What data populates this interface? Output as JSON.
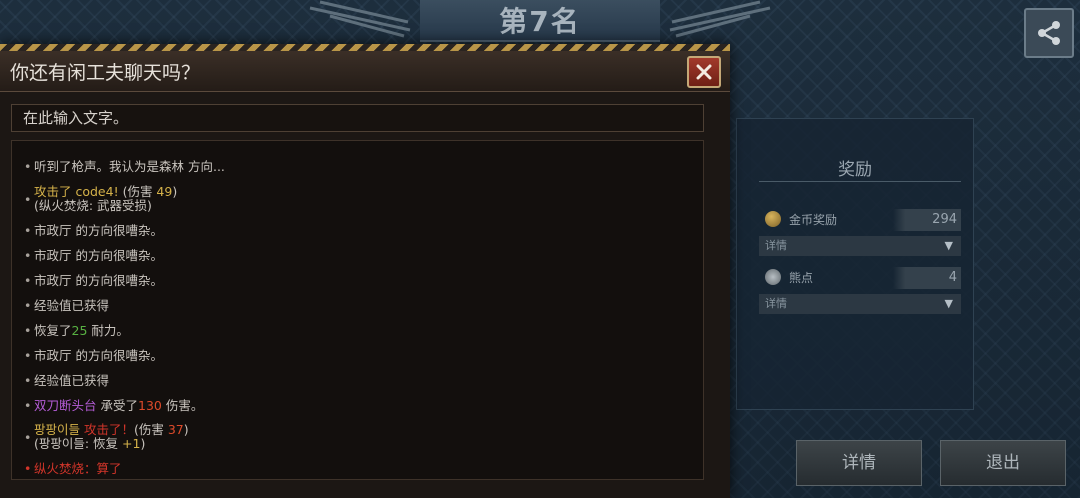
{
  "background": {
    "rank_title": "第7名",
    "reward": {
      "title": "奖励",
      "gold_label": "金币奖励",
      "gold_value": "294",
      "gold_detail": "详情",
      "bear_label": "熊点",
      "bear_value": "4",
      "bear_detail": "详情"
    },
    "buttons": {
      "details": "详情",
      "exit": "退出"
    }
  },
  "chat": {
    "title": "你还有闲工夫聊天吗？",
    "input_placeholder": "在此输入文字。",
    "messages": [
      {
        "text": "听到了枪声。我认为是森林 方向..."
      },
      {
        "actor": "攻击了 code4!",
        "mid": " (伤害 ",
        "dmg": "49",
        "end": ")",
        "sub": "(纵火焚烧: 武器受损)"
      },
      {
        "text": "市政厅 的方向很嘈杂。"
      },
      {
        "text": "市政厅 的方向很嘈杂。"
      },
      {
        "text": "市政厅 的方向很嘈杂。"
      },
      {
        "text": "经验值已获得"
      },
      {
        "pre": "恢复了",
        "num": "25",
        "post": " 耐力。"
      },
      {
        "text": "市政厅 的方向很嘈杂。"
      },
      {
        "text": "经验值已获得"
      },
      {
        "name": "双刀断头台",
        "mid": " 承受了",
        "num": "130",
        "post": " 伤害。"
      },
      {
        "name": "팡팡이들",
        "actor": "  攻击了！",
        "mid": "(伤害 ",
        "dmg": "37",
        "end": ")",
        "sub_pre": "(팡팡이들: 恢复 ",
        "sub_num": "+1",
        "sub_end": ")"
      },
      {
        "text": "纵火焚烧：算了"
      }
    ]
  },
  "colors": {
    "gold": "#d5b24a",
    "green": "#58b142",
    "purple": "#b45cd6",
    "red": "#d2352a"
  },
  "icons": [
    "share-icon",
    "close-icon",
    "coin-icon",
    "bear-icon",
    "chevron-down-icon"
  ]
}
